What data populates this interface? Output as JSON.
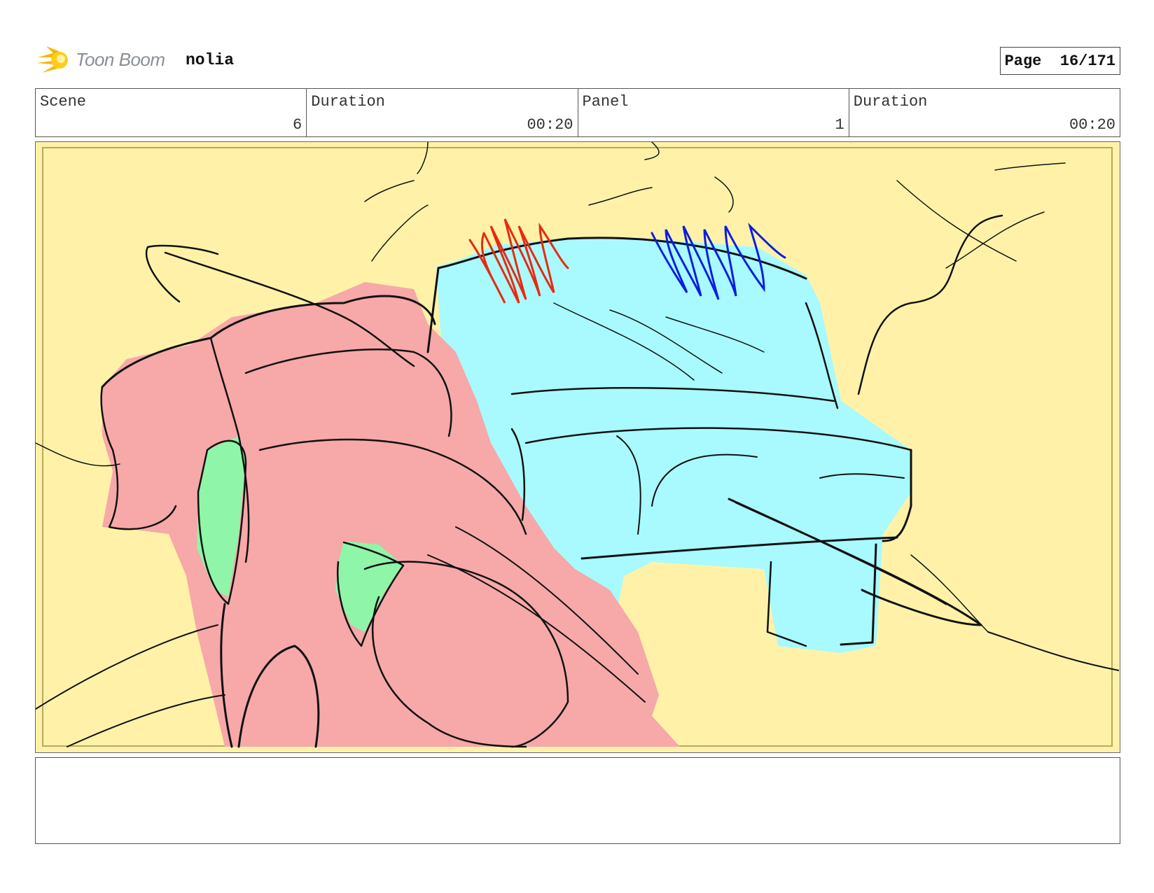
{
  "header": {
    "brand": "Toon Boom",
    "project": "nolia",
    "page": "Page  16/171"
  },
  "info": {
    "scene_label": "Scene",
    "scene_value": "6",
    "scene_duration_label": "Duration",
    "scene_duration_value": "00:20",
    "panel_label": "Panel",
    "panel_value": "1",
    "panel_duration_label": "Duration",
    "panel_duration_value": "00:20"
  },
  "notes": {
    "text": ""
  },
  "colors": {
    "background": "#fff2a8",
    "character": "#f7a8a8",
    "vehicle": "#a8faff",
    "accent_green": "#8ff5a8",
    "scribble_red": "#e82a10",
    "scribble_blue": "#0a1ee0"
  }
}
